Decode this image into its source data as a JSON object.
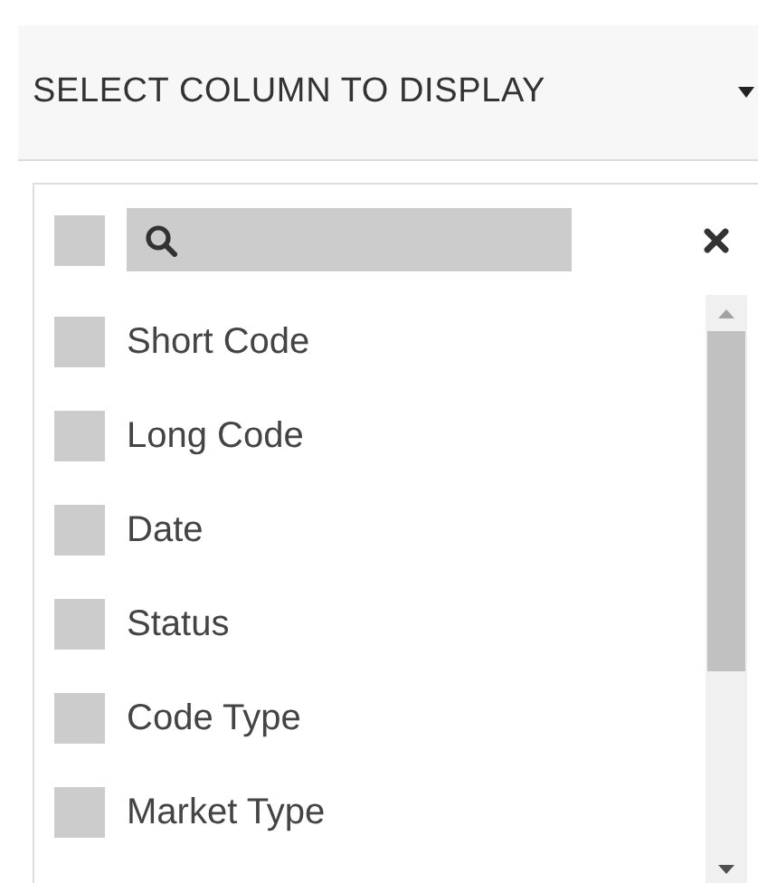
{
  "header": {
    "title": "SELECT COLUMN TO DISPLAY"
  },
  "search": {
    "select_all_checked": false
  },
  "columns": [
    {
      "label": "Short Code",
      "checked": false
    },
    {
      "label": "Long Code",
      "checked": false
    },
    {
      "label": "Date",
      "checked": false
    },
    {
      "label": "Status",
      "checked": false
    },
    {
      "label": "Code Type",
      "checked": false
    },
    {
      "label": "Market Type",
      "checked": false
    }
  ]
}
